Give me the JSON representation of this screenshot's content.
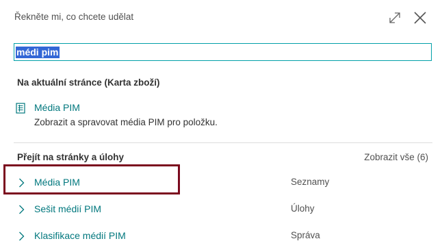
{
  "dialog": {
    "title": "Řekněte mi, co chcete udělat"
  },
  "icons": {
    "expand": "expand-icon",
    "close": "close-icon",
    "page": "page-icon",
    "chevron": "chevron-right-icon"
  },
  "search": {
    "value": "médi pim"
  },
  "current_page": {
    "heading": "Na aktuální stránce (Karta zboží)",
    "item": {
      "label": "Média PIM",
      "description": "Zobrazit a spravovat média PIM pro položku."
    }
  },
  "pages_tasks": {
    "heading": "Přejít na stránky a úlohy",
    "show_all": "Zobrazit vše (6)",
    "results": [
      {
        "label": "Média PIM",
        "category": "Seznamy"
      },
      {
        "label": "Sešit médií PIM",
        "category": "Úlohy"
      },
      {
        "label": "Klasifikace médií PIM",
        "category": "Správa"
      }
    ]
  },
  "colors": {
    "accent": "#00a0a8",
    "link": "#00777d",
    "selection": "#3367d6",
    "highlight_frame": "#7b0a1e"
  }
}
